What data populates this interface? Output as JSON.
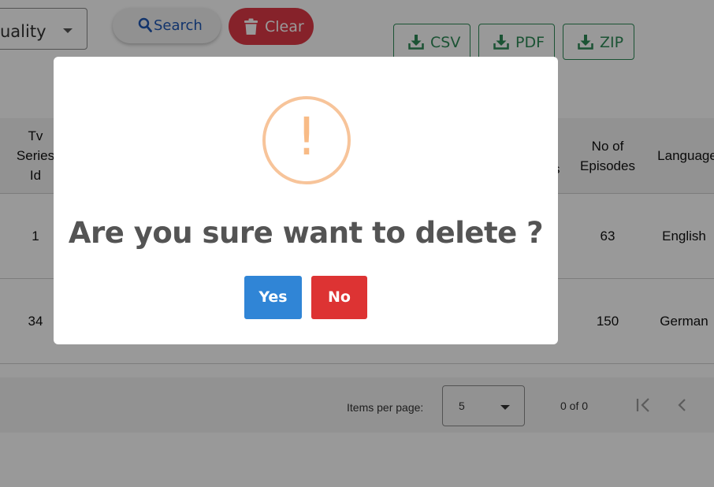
{
  "toolbar": {
    "quality_value": "uality",
    "search_label": "Search",
    "clear_label": "Clear",
    "csv_label": "CSV",
    "pdf_label": "PDF",
    "zip_label": "ZIP"
  },
  "table": {
    "headers": {
      "id_lines": [
        "Tv",
        "Series",
        "Id"
      ],
      "episodes_lines": [
        "No of",
        "Episodes"
      ],
      "language": "Language",
      "partial": "s"
    },
    "rows": [
      {
        "id": "1",
        "episodes": "63",
        "language": "English"
      },
      {
        "id": "34",
        "episodes": "150",
        "language": "German"
      }
    ]
  },
  "paginator": {
    "items_per_page_label": "Items per page:",
    "items_per_page_value": "5",
    "range_label": "0 of 0"
  },
  "dialog": {
    "icon": "warning-exclamation-icon",
    "icon_color": "#f8bb86",
    "title": "Are you sure want to delete ?",
    "yes_label": "Yes",
    "no_label": "No",
    "yes_color": "#3085d6",
    "no_color": "#dd3333"
  }
}
